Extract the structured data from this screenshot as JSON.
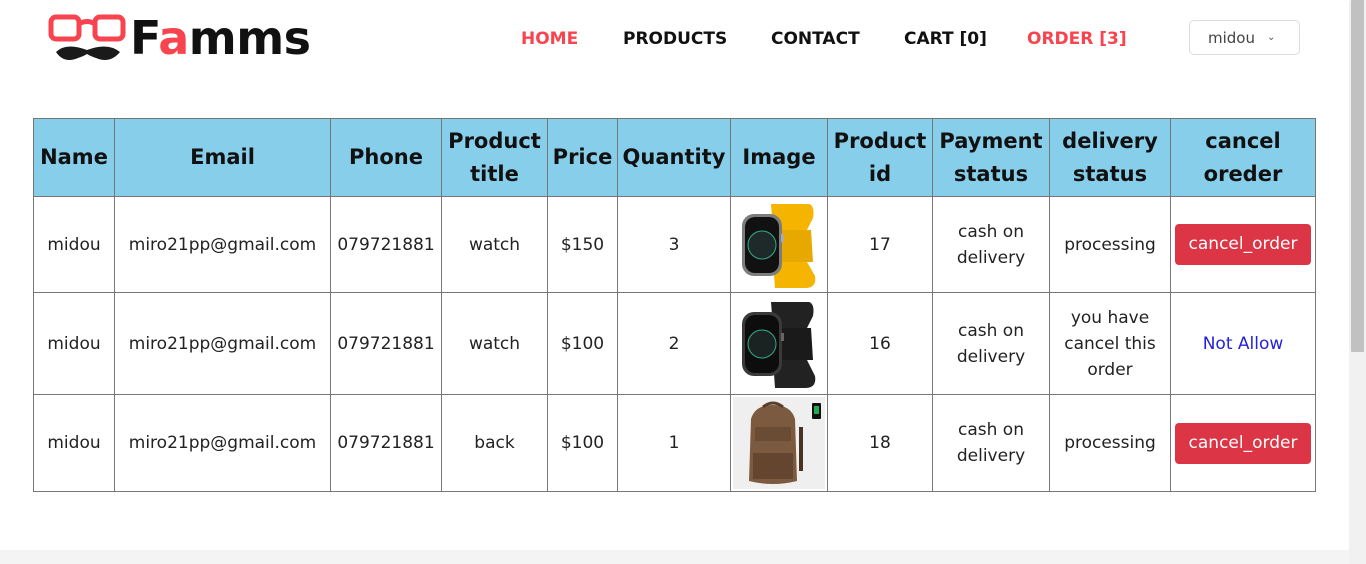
{
  "brand": {
    "name_before": "F",
    "name_accent": "a",
    "name_after": "mms",
    "accent_color": "#f7444e"
  },
  "nav": {
    "home": "HOME",
    "products": "PRODUCTS",
    "contact": "CONTACT",
    "cart": "CART [0]",
    "order": "ORDER [3]"
  },
  "user_menu": {
    "selected": "midou"
  },
  "table": {
    "header_color": "#87ceeb",
    "headers": {
      "name": "Name",
      "email": "Email",
      "phone": "Phone",
      "product_title_1": "Product",
      "product_title_2": "title",
      "price": "Price",
      "quantity": "Quantity",
      "image": "Image",
      "product_id_1": "Product",
      "product_id_2": "id",
      "payment_1": "Payment",
      "payment_2": "status",
      "delivery_1": "delivery",
      "delivery_2": "status",
      "cancel_1": "cancel",
      "cancel_2": "oreder"
    },
    "rows": [
      {
        "name": "midou",
        "email": "miro21pp@gmail.com",
        "phone": "079721881",
        "title": "watch",
        "price": "$150",
        "quantity": "3",
        "image": "yellow-band-smartwatch",
        "product_id": "17",
        "payment_1": "cash on",
        "payment_2": "delivery",
        "delivery_1": "processing",
        "delivery_2": "",
        "delivery_3": "",
        "action": "cancel_order"
      },
      {
        "name": "midou",
        "email": "miro21pp@gmail.com",
        "phone": "079721881",
        "title": "watch",
        "price": "$100",
        "quantity": "2",
        "image": "black-band-smartwatch",
        "product_id": "16",
        "payment_1": "cash on",
        "payment_2": "delivery",
        "delivery_1": "you have",
        "delivery_2": "cancel this",
        "delivery_3": "order",
        "action": "Not Allow"
      },
      {
        "name": "midou",
        "email": "miro21pp@gmail.com",
        "phone": "079721881",
        "title": "back",
        "price": "$100",
        "quantity": "1",
        "image": "brown-leather-backpack",
        "product_id": "18",
        "payment_1": "cash on",
        "payment_2": "delivery",
        "delivery_1": "processing",
        "delivery_2": "",
        "delivery_3": "",
        "action": "cancel_order"
      }
    ]
  }
}
